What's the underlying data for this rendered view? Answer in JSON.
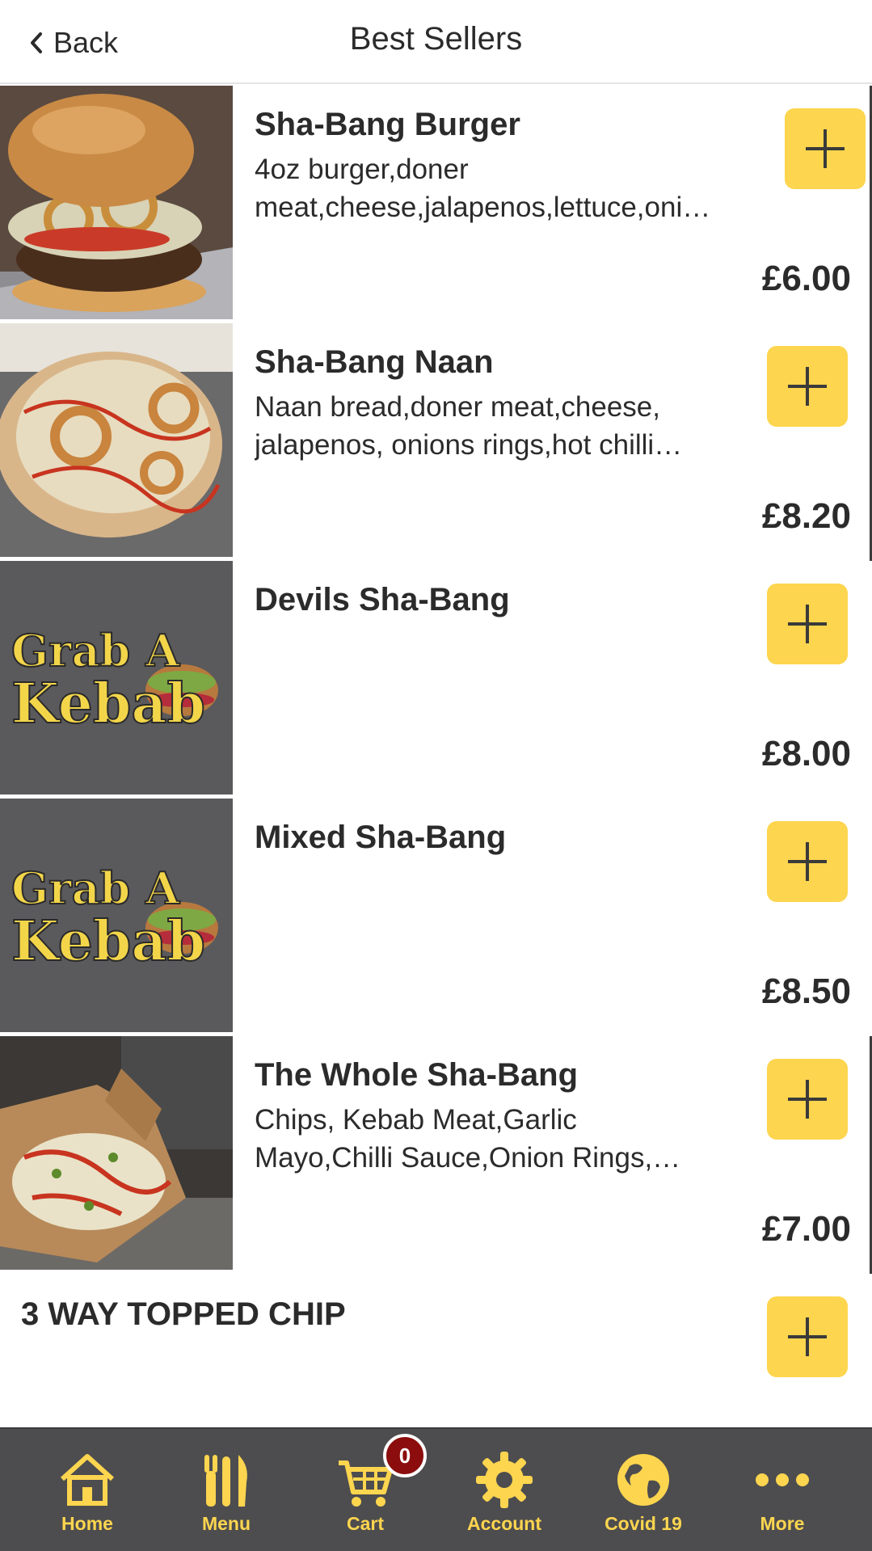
{
  "header": {
    "back_label": "Back",
    "title": "Best Sellers"
  },
  "items": [
    {
      "name": "Sha-Bang Burger",
      "desc_line1": "4oz burger,doner",
      "desc_line2": "meat,cheese,jalapenos,lettuce,oni…",
      "price": "£6.00",
      "image": "burger-photo"
    },
    {
      "name": "Sha-Bang Naan",
      "desc_line1": "Naan bread,doner meat,cheese,",
      "desc_line2": "jalapenos, onions rings,hot chilli…",
      "price": "£8.20",
      "image": "naan-photo"
    },
    {
      "name": "Devils Sha-Bang",
      "desc_line1": "",
      "desc_line2": "",
      "price": "£8.00",
      "image": "grab-a-kebab-logo",
      "logo_line1": "Grab A",
      "logo_line2": "Kebab"
    },
    {
      "name": "Mixed Sha-Bang",
      "desc_line1": "",
      "desc_line2": "",
      "price": "£8.50",
      "image": "grab-a-kebab-logo",
      "logo_line1": "Grab A",
      "logo_line2": "Kebab"
    },
    {
      "name": "The Whole Sha-Bang",
      "desc_line1": "Chips, Kebab Meat,Garlic",
      "desc_line2": "Mayo,Chilli Sauce,Onion Rings,…",
      "price": "£7.00",
      "image": "chips-box-photo"
    }
  ],
  "section": {
    "title": "3 WAY TOPPED CHIP"
  },
  "tabbar": {
    "tabs": [
      {
        "label": "Home",
        "icon": "home-icon"
      },
      {
        "label": "Menu",
        "icon": "cutlery-icon"
      },
      {
        "label": "Cart",
        "icon": "cart-icon",
        "badge": "0"
      },
      {
        "label": "Account",
        "icon": "gear-icon"
      },
      {
        "label": "Covid 19",
        "icon": "globe-icon"
      },
      {
        "label": "More",
        "icon": "more-dots-icon"
      }
    ]
  },
  "colors": {
    "accent": "#fdd54f",
    "tabbar_bg": "#4d4d4f",
    "badge_bg": "#8b0d0d",
    "text": "#2b2b2b"
  }
}
